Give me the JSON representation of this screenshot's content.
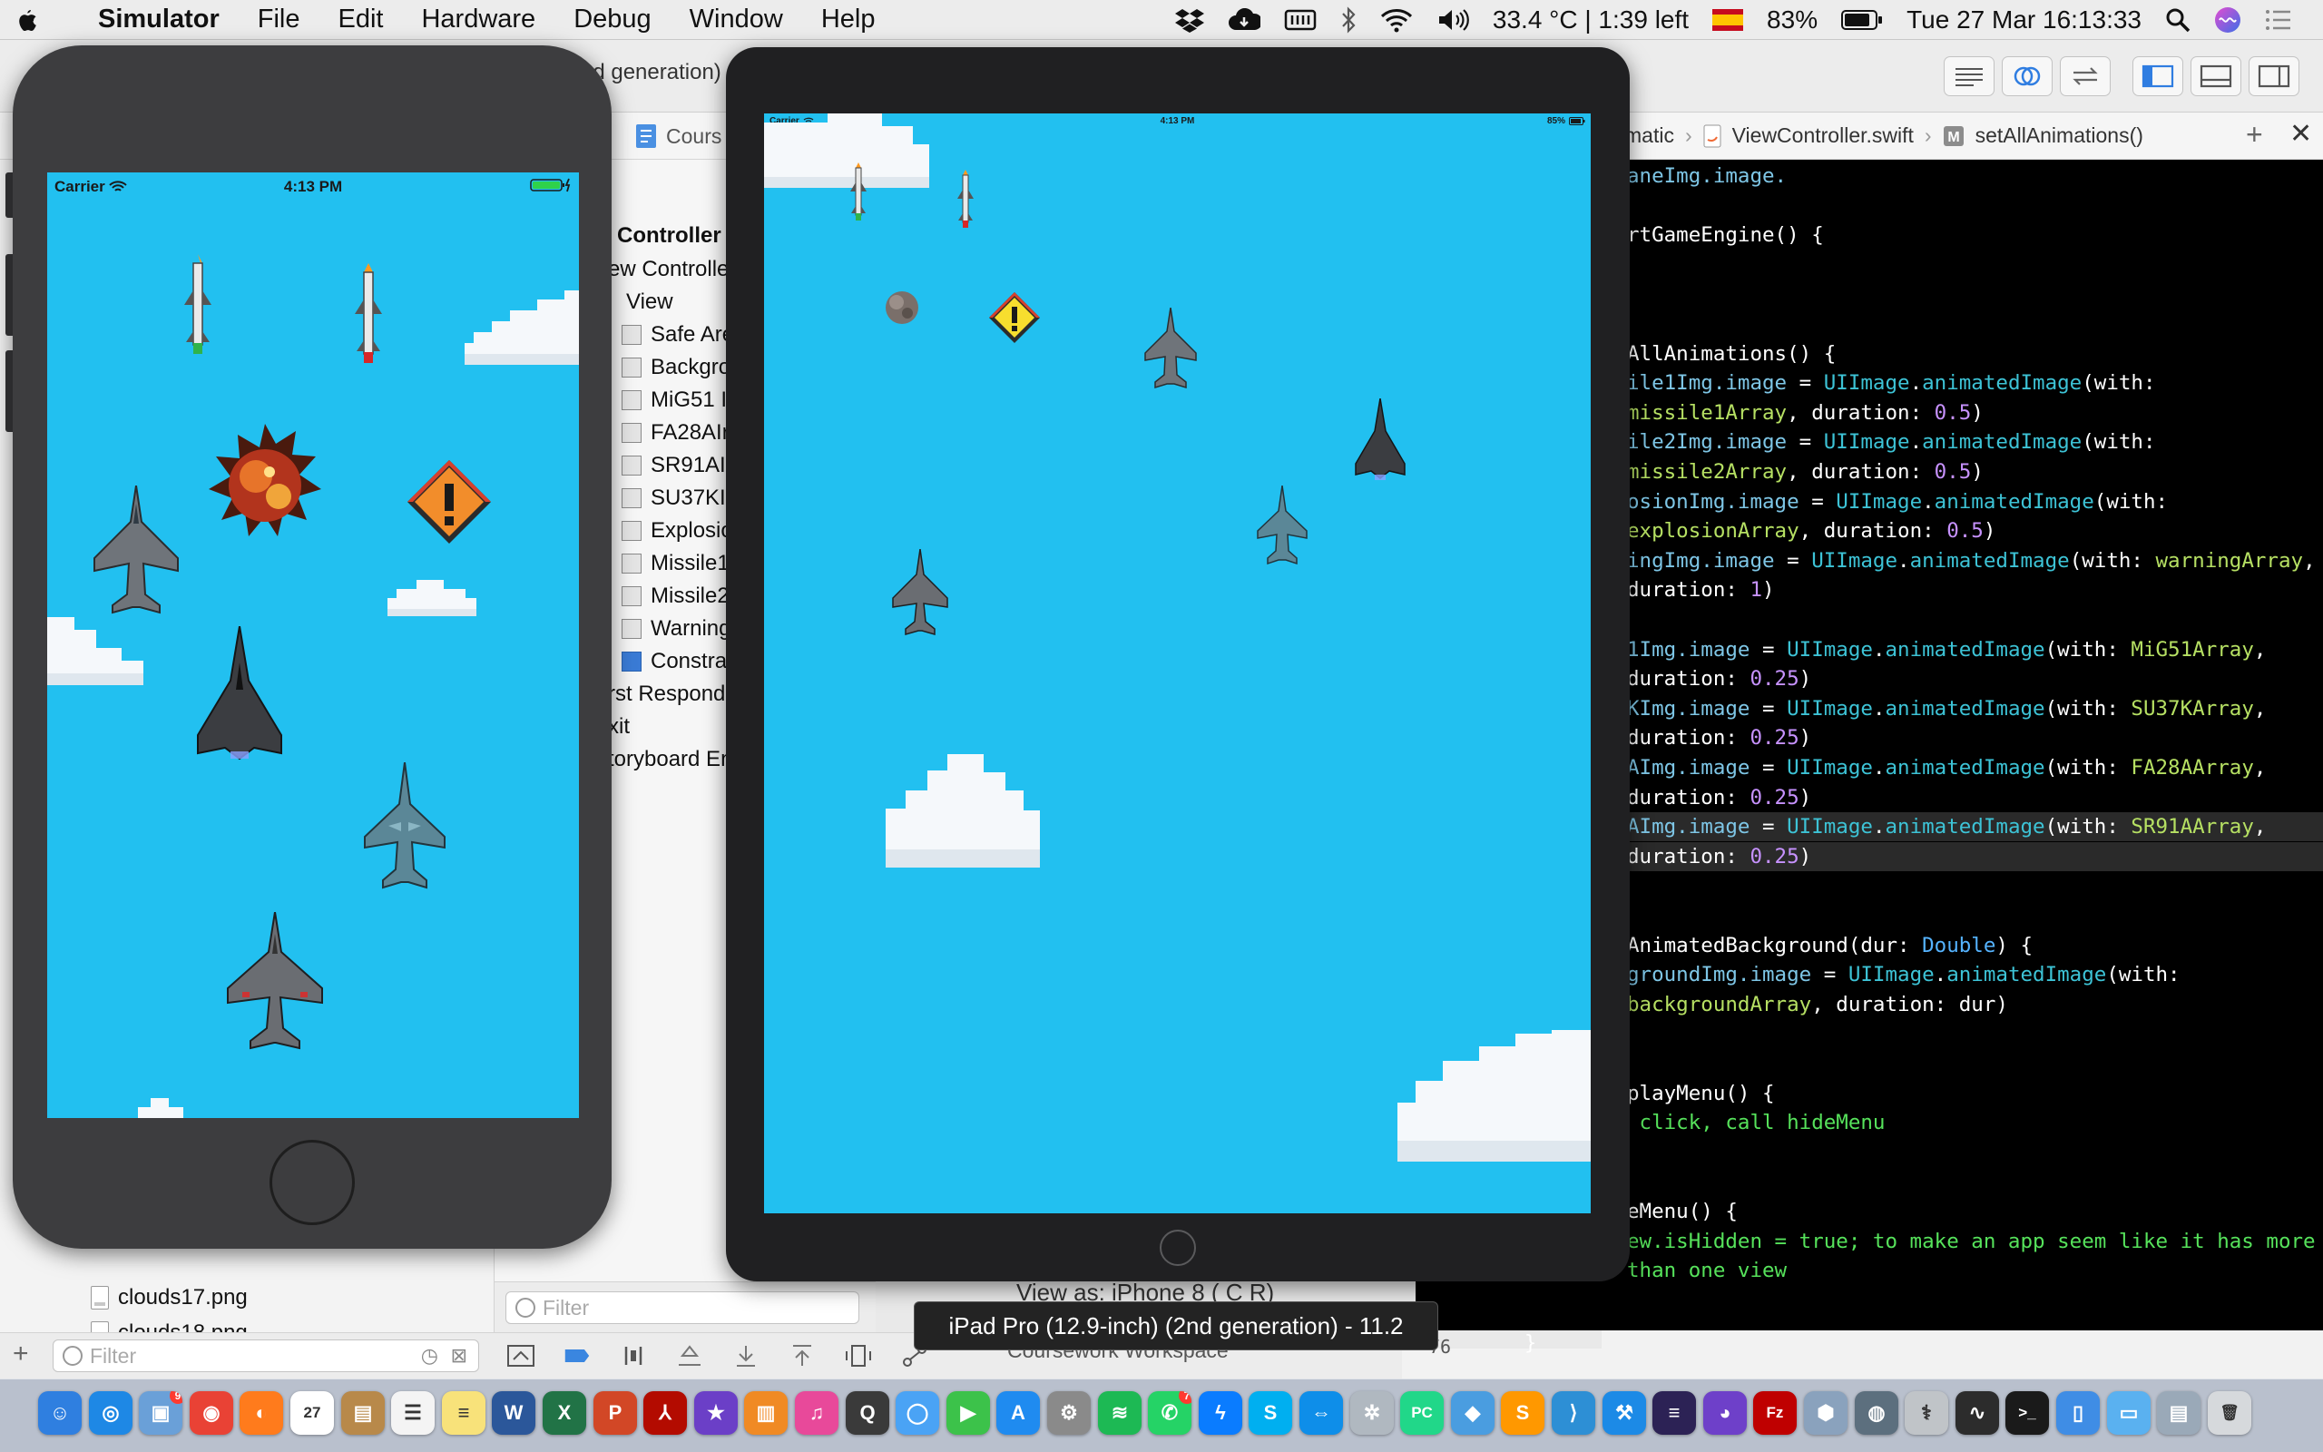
{
  "menubar": {
    "app_name": "Simulator",
    "menus": [
      "File",
      "Edit",
      "Hardware",
      "Debug",
      "Window",
      "Help"
    ],
    "temperature": "33.4 °C | 1:39 left",
    "battery": "83%",
    "datetime": "Tue 27 Mar  16:13:33"
  },
  "xcode": {
    "window_title": "nd generation)",
    "tab_left": "Cours",
    "breadcrumb": {
      "first": "matic",
      "file": "ViewController.swift",
      "method": "setAllAnimations()"
    },
    "navigator_files": [
      "clouds17.png",
      "clouds18.png"
    ],
    "navigator_filter_placeholder": "Filter",
    "outline": {
      "scene_title": "Controller S",
      "rows": [
        "ew Controlle",
        "View",
        "Safe Are",
        "Backgro",
        "MiG51 I",
        "FA28AIr",
        "SR91AIr",
        "SU37KI",
        "Explosio",
        "Missile1",
        "Missile2",
        "Warning",
        "Constra",
        "rst Respond",
        "xit",
        "toryboard En"
      ]
    },
    "outline_filter_placeholder": "Filter",
    "view_as": "View as: iPhone 8 (  C  R)",
    "workspace": "Coursework Workspace",
    "line_number": "76",
    "closing_brace": "}"
  },
  "code_lines": [
    {
      "y": 0,
      "parts": [
        [
          "t-id",
          "aneImg.image."
        ]
      ]
    },
    {
      "y": 2,
      "parts": [
        [
          "t-pl",
          "rtGameEngine() {"
        ]
      ]
    },
    {
      "y": 6,
      "parts": [
        [
          "t-pl",
          "AllAnimations() {"
        ]
      ]
    },
    {
      "y": 7,
      "parts": [
        [
          "t-id",
          "ile1Img.image"
        ],
        [
          "t-pl",
          " = "
        ],
        [
          "t-fn",
          "UIImage"
        ],
        [
          "t-pl",
          "."
        ],
        [
          "t-fn",
          "animatedImage"
        ],
        [
          "t-pl",
          "(with:"
        ]
      ]
    },
    {
      "y": 8,
      "parts": [
        [
          "t-ygr",
          "missile1Array"
        ],
        [
          "t-pl",
          ", duration: "
        ],
        [
          "t-num",
          "0.5"
        ],
        [
          "t-pl",
          ")"
        ]
      ]
    },
    {
      "y": 9,
      "parts": [
        [
          "t-id",
          "ile2Img.image"
        ],
        [
          "t-pl",
          " = "
        ],
        [
          "t-fn",
          "UIImage"
        ],
        [
          "t-pl",
          "."
        ],
        [
          "t-fn",
          "animatedImage"
        ],
        [
          "t-pl",
          "(with:"
        ]
      ]
    },
    {
      "y": 10,
      "parts": [
        [
          "t-ygr",
          "missile2Array"
        ],
        [
          "t-pl",
          ", duration: "
        ],
        [
          "t-num",
          "0.5"
        ],
        [
          "t-pl",
          ")"
        ]
      ]
    },
    {
      "y": 11,
      "parts": [
        [
          "t-id",
          "osionImg.image"
        ],
        [
          "t-pl",
          " = "
        ],
        [
          "t-fn",
          "UIImage"
        ],
        [
          "t-pl",
          "."
        ],
        [
          "t-fn",
          "animatedImage"
        ],
        [
          "t-pl",
          "(with:"
        ]
      ]
    },
    {
      "y": 12,
      "parts": [
        [
          "t-ygr",
          "explosionArray"
        ],
        [
          "t-pl",
          ", duration: "
        ],
        [
          "t-num",
          "0.5"
        ],
        [
          "t-pl",
          ")"
        ]
      ]
    },
    {
      "y": 13,
      "parts": [
        [
          "t-id",
          "ingImg.image"
        ],
        [
          "t-pl",
          " = "
        ],
        [
          "t-fn",
          "UIImage"
        ],
        [
          "t-pl",
          "."
        ],
        [
          "t-fn",
          "animatedImage"
        ],
        [
          "t-pl",
          "(with: "
        ],
        [
          "t-ygr",
          "warningArray"
        ],
        [
          "t-pl",
          ","
        ]
      ]
    },
    {
      "y": 14,
      "parts": [
        [
          "t-pl",
          "duration: "
        ],
        [
          "t-num",
          "1"
        ],
        [
          "t-pl",
          ")"
        ]
      ]
    },
    {
      "y": 16,
      "parts": [
        [
          "t-id",
          "1Img.image"
        ],
        [
          "t-pl",
          " = "
        ],
        [
          "t-fn",
          "UIImage"
        ],
        [
          "t-pl",
          "."
        ],
        [
          "t-fn",
          "animatedImage"
        ],
        [
          "t-pl",
          "(with: "
        ],
        [
          "t-ygr",
          "MiG51Array"
        ],
        [
          "t-pl",
          ","
        ]
      ]
    },
    {
      "y": 17,
      "parts": [
        [
          "t-pl",
          "duration: "
        ],
        [
          "t-num",
          "0.25"
        ],
        [
          "t-pl",
          ")"
        ]
      ]
    },
    {
      "y": 18,
      "parts": [
        [
          "t-id",
          "KImg.image"
        ],
        [
          "t-pl",
          " = "
        ],
        [
          "t-fn",
          "UIImage"
        ],
        [
          "t-pl",
          "."
        ],
        [
          "t-fn",
          "animatedImage"
        ],
        [
          "t-pl",
          "(with: "
        ],
        [
          "t-ygr",
          "SU37KArray"
        ],
        [
          "t-pl",
          ","
        ]
      ]
    },
    {
      "y": 19,
      "parts": [
        [
          "t-pl",
          "duration: "
        ],
        [
          "t-num",
          "0.25"
        ],
        [
          "t-pl",
          ")"
        ]
      ]
    },
    {
      "y": 20,
      "parts": [
        [
          "t-id",
          "AImg.image"
        ],
        [
          "t-pl",
          " = "
        ],
        [
          "t-fn",
          "UIImage"
        ],
        [
          "t-pl",
          "."
        ],
        [
          "t-fn",
          "animatedImage"
        ],
        [
          "t-pl",
          "(with: "
        ],
        [
          "t-ygr",
          "FA28AArray"
        ],
        [
          "t-pl",
          ","
        ]
      ]
    },
    {
      "y": 21,
      "parts": [
        [
          "t-pl",
          "duration: "
        ],
        [
          "t-num",
          "0.25"
        ],
        [
          "t-pl",
          ")"
        ]
      ]
    },
    {
      "y": 22,
      "hl": true,
      "parts": [
        [
          "t-id",
          "AImg.image"
        ],
        [
          "t-pl",
          " = "
        ],
        [
          "t-fn",
          "UIImage"
        ],
        [
          "t-pl",
          "."
        ],
        [
          "t-fn",
          "animatedImage"
        ],
        [
          "t-pl",
          "(with: "
        ],
        [
          "t-ygr",
          "SR91AArray"
        ],
        [
          "t-pl",
          ","
        ]
      ]
    },
    {
      "y": 23,
      "hl": true,
      "parts": [
        [
          "t-pl",
          "duration: "
        ],
        [
          "t-num",
          "0.25"
        ],
        [
          "t-pl",
          ")"
        ]
      ]
    },
    {
      "y": 26,
      "parts": [
        [
          "t-pl",
          "AnimatedBackground(dur: "
        ],
        [
          "t-type",
          "Double"
        ],
        [
          "t-pl",
          ") {"
        ]
      ]
    },
    {
      "y": 27,
      "parts": [
        [
          "t-id",
          "groundImg.image"
        ],
        [
          "t-pl",
          " = "
        ],
        [
          "t-fn",
          "UIImage"
        ],
        [
          "t-pl",
          "."
        ],
        [
          "t-fn",
          "animatedImage"
        ],
        [
          "t-pl",
          "(with:"
        ]
      ]
    },
    {
      "y": 28,
      "parts": [
        [
          "t-ygr",
          "backgroundArray"
        ],
        [
          "t-pl",
          ", duration: dur)"
        ]
      ]
    },
    {
      "y": 31,
      "parts": [
        [
          "t-pl",
          "playMenu() {"
        ]
      ]
    },
    {
      "y": 32,
      "parts": [
        [
          "t-gr",
          " click, call hideMenu"
        ]
      ]
    },
    {
      "y": 35,
      "parts": [
        [
          "t-pl",
          "eMenu() {"
        ]
      ]
    },
    {
      "y": 36,
      "parts": [
        [
          "t-gr",
          "ew.isHidden = true; to make an app seem like it has more"
        ]
      ]
    },
    {
      "y": 37,
      "parts": [
        [
          "t-gr",
          "than one view"
        ]
      ]
    }
  ],
  "iphone": {
    "carrier": "Carrier",
    "time": "4:13 PM"
  },
  "ipad": {
    "carrier": "Carrier",
    "time": "4:13 PM",
    "battery": "85%"
  },
  "tooltip": "iPad Pro (12.9-inch) (2nd generation) - 11.2",
  "dock": {
    "apps": [
      {
        "name": "Finder",
        "icon": "finder-icon",
        "color": "#2f7fe0",
        "glyph": "☺"
      },
      {
        "name": "Safari",
        "icon": "safari-icon",
        "color": "#1e88e5",
        "glyph": "◎"
      },
      {
        "name": "Preview",
        "icon": "preview-icon",
        "color": "#6aa0d8",
        "glyph": "▣",
        "badge": "9"
      },
      {
        "name": "Chrome",
        "icon": "chrome-icon",
        "color": "#e94235",
        "glyph": "◉"
      },
      {
        "name": "Firefox",
        "icon": "firefox-icon",
        "color": "#ff7b1c",
        "glyph": "◐"
      },
      {
        "name": "Calendar",
        "icon": "calendar-icon",
        "color": "#ffffff",
        "glyph": "27"
      },
      {
        "name": "Notefile",
        "icon": "notebook-icon",
        "color": "#b8894a",
        "glyph": "▤"
      },
      {
        "name": "Reminders",
        "icon": "reminders-icon",
        "color": "#f4f4f4",
        "glyph": "☰"
      },
      {
        "name": "Notes",
        "icon": "notes-icon",
        "color": "#f8e27a",
        "glyph": "≡"
      },
      {
        "name": "Word",
        "icon": "word-icon",
        "color": "#2b579a",
        "glyph": "W"
      },
      {
        "name": "Excel",
        "icon": "excel-icon",
        "color": "#217346",
        "glyph": "X"
      },
      {
        "name": "PowerPoint",
        "icon": "powerpoint-icon",
        "color": "#d24726",
        "glyph": "P"
      },
      {
        "name": "Acrobat",
        "icon": "acrobat-icon",
        "color": "#b30b00",
        "glyph": "⅄"
      },
      {
        "name": "iMovie",
        "icon": "imovie-icon",
        "color": "#6b3fc7",
        "glyph": "★"
      },
      {
        "name": "Books",
        "icon": "books-icon",
        "color": "#f08a24",
        "glyph": "▥"
      },
      {
        "name": "iTunes",
        "icon": "itunes-icon",
        "color": "#e8499a",
        "glyph": "♫"
      },
      {
        "name": "QuickTime",
        "icon": "quicktime-icon",
        "color": "#3a3a3a",
        "glyph": "Q"
      },
      {
        "name": "Messages",
        "icon": "messages-icon",
        "color": "#4aa3f5",
        "glyph": "◯"
      },
      {
        "name": "FaceTime",
        "icon": "facetime-icon",
        "color": "#3cc24a",
        "glyph": "▶"
      },
      {
        "name": "App Store",
        "icon": "appstore-icon",
        "color": "#1f8bf0",
        "glyph": "A"
      },
      {
        "name": "System Preferences",
        "icon": "settings-icon",
        "color": "#8a8a8a",
        "glyph": "⚙"
      },
      {
        "name": "Spotify",
        "icon": "spotify-icon",
        "color": "#1db954",
        "glyph": "≋"
      },
      {
        "name": "WhatsApp",
        "icon": "whatsapp-icon",
        "color": "#25d366",
        "glyph": "✆",
        "badge": "7"
      },
      {
        "name": "Messenger",
        "icon": "messenger-icon",
        "color": "#0a7cff",
        "glyph": "ϟ"
      },
      {
        "name": "Skype",
        "icon": "skype-icon",
        "color": "#00aff0",
        "glyph": "S"
      },
      {
        "name": "TeamViewer",
        "icon": "teamviewer-icon",
        "color": "#0e8ee9",
        "glyph": "⇔"
      },
      {
        "name": "Utility",
        "icon": "utility-icon",
        "color": "#b0b8c0",
        "glyph": "✲"
      },
      {
        "name": "PyCharm",
        "icon": "pycharm-icon",
        "color": "#21d789",
        "glyph": "PC"
      },
      {
        "name": "Blue Cube",
        "icon": "cube-icon",
        "color": "#4a9de0",
        "glyph": "◆"
      },
      {
        "name": "Sublime Text",
        "icon": "sublime-icon",
        "color": "#ff9800",
        "glyph": "S"
      },
      {
        "name": "VS Code",
        "icon": "vscode-icon",
        "color": "#2d8fd5",
        "glyph": "⟩"
      },
      {
        "name": "Xcode",
        "icon": "xcode-icon",
        "color": "#1c8ae6",
        "glyph": "⚒"
      },
      {
        "name": "Eclipse",
        "icon": "eclipse-icon",
        "color": "#2c2255",
        "glyph": "≡"
      },
      {
        "name": "GitHub Desktop",
        "icon": "github-icon",
        "color": "#6e40c9",
        "glyph": "◕"
      },
      {
        "name": "FileZilla",
        "icon": "filezilla-icon",
        "color": "#bf0000",
        "glyph": "Fz"
      },
      {
        "name": "VirtualBox",
        "icon": "virtualbox-icon",
        "color": "#8aa2bd",
        "glyph": "⬢"
      },
      {
        "name": "Network Utility",
        "icon": "network-icon",
        "color": "#5c6f7e",
        "glyph": "◍"
      },
      {
        "name": "Disk Utility",
        "icon": "disk-utility-icon",
        "color": "#c0c4c8",
        "glyph": "⚕"
      },
      {
        "name": "Activity Monitor",
        "icon": "activity-monitor-icon",
        "color": "#2c2c2c",
        "glyph": "∿"
      },
      {
        "name": "Terminal",
        "icon": "terminal-icon",
        "color": "#1a1a1a",
        "glyph": ">_"
      },
      {
        "name": "Simulator",
        "icon": "simulator-icon",
        "color": "#3f8de5",
        "glyph": "▯"
      },
      {
        "name": "Folder",
        "icon": "folder-icon",
        "color": "#5ab1f0",
        "glyph": "▭"
      },
      {
        "name": "Downloads",
        "icon": "downloads-stack-icon",
        "color": "#9aa9b8",
        "glyph": "▤"
      },
      {
        "name": "Trash",
        "icon": "trash-icon",
        "color": "#d6d9dc",
        "glyph": "🗑"
      }
    ]
  }
}
